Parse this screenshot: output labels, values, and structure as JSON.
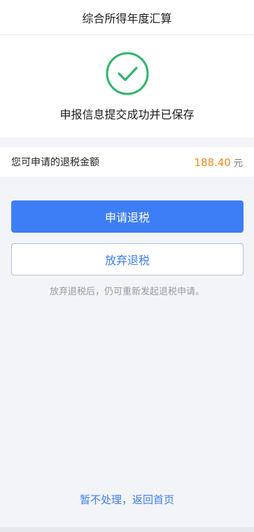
{
  "header": {
    "title": "综合所得年度汇算"
  },
  "status": {
    "message": "申报信息提交成功并已保存",
    "icon": "check-circle-icon",
    "color": "#2fb46a"
  },
  "refund": {
    "label": "您可申请的退税金额",
    "amount": "188.40",
    "unit": "元"
  },
  "actions": {
    "apply_label": "申请退税",
    "abandon_label": "放弃退税",
    "hint": "放弃退税后，仍可重新发起退税申请。"
  },
  "footer": {
    "back_home_label": "暂不处理，返回首页"
  },
  "colors": {
    "accent": "#3d7ef7",
    "amount": "#f08a24",
    "success": "#2fb46a"
  }
}
